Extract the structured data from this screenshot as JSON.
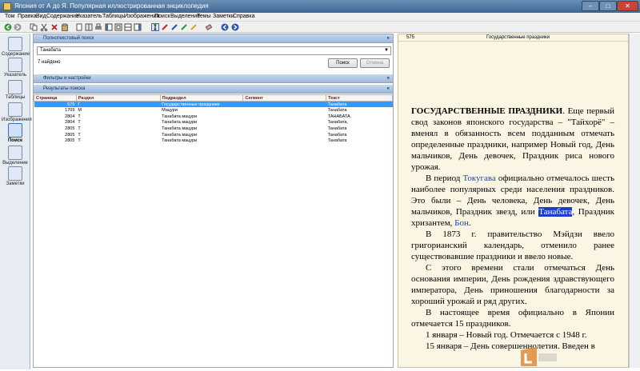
{
  "window": {
    "title": "Япония от А до Я. Популярная иллюстрированная энциклопедия"
  },
  "menu": [
    "Том",
    "Правка",
    "Вид",
    "Содержание",
    "Указатель",
    "Таблицы",
    "Изображения",
    "Поиск",
    "Выделение",
    "Темы",
    "Заметки",
    "Справка"
  ],
  "sidebar": {
    "items": [
      {
        "label": "Содержание"
      },
      {
        "label": "Указатель"
      },
      {
        "label": "Таблицы"
      },
      {
        "label": "Изображения"
      },
      {
        "label": "Поиск"
      },
      {
        "label": "Выделение"
      },
      {
        "label": "Заметки"
      }
    ]
  },
  "search": {
    "section_title": "Полнотекстовый поиск",
    "query": "Танабата",
    "found": "7 найдено",
    "search_button": "Поиск",
    "cancel_button": "Отмена",
    "filters_title": "Фильтры и настройки",
    "results_title": "Результаты поиска"
  },
  "results": {
    "columns": [
      "Страница",
      "Раздел",
      "Подраздел",
      "Сегмент",
      "Текст"
    ],
    "rows": [
      [
        "575",
        "Г",
        "Государственные праздники",
        "",
        "Танабата"
      ],
      [
        "1709",
        "М",
        "Мацури",
        "",
        "Танабата"
      ],
      [
        "2804",
        "Т",
        "Танабата мацури",
        "",
        "ТАНАБАТА"
      ],
      [
        "2804",
        "Т",
        "Танабата мацури",
        "",
        "Танабата,"
      ],
      [
        "2805",
        "Т",
        "Танабата мацури",
        "",
        "Танабата"
      ],
      [
        "2805",
        "Т",
        "Танабата мацури",
        "",
        "Танабата"
      ],
      [
        "2805",
        "Т",
        "Танабата мацури",
        "",
        "Танабата"
      ]
    ]
  },
  "page": {
    "number": "575",
    "title": "Государственные праздники"
  },
  "article": {
    "heading": "ГОСУДАРСТВЕННЫЕ ПРАЗДНИКИ",
    "p1": ". Еще первый свод законов японского государства – \"Тайхорё\" – вменял в обязанность всем подданным отмечать определенные праздники, например Новый год, День мальчиков, День девочек, Праздник риса нового урожая.",
    "p2a": "В период ",
    "p2_link1": "Токугава",
    "p2b": " официально отмечалось шесть наиболее популярных среди населения праздников. Это были – День человека, День девочек, День мальчиков, Праздник звезд, или ",
    "p2_hl": "Танабата",
    "p2c": ", Праздник хризантем, ",
    "p2_link2": "Бон",
    "p2d": ".",
    "p3": "В 1873 г. правительство Мэйдзи ввело григорианский календарь, отменило ранее существовавшие праздники и ввело новые.",
    "p4": "С этого времени стали отмечаться День основания империи, День рождения здравствующего императора, День приношения благодарности за хороший урожай и ряд других.",
    "p5": "В настоящее время официально в Японии отмечается 15 праздников.",
    "p6": "1 января – Новый год. Отмечается с 1948 г.",
    "p7": "15 января – День совершеннолетия. Введен в"
  },
  "colors": {
    "selection": "#3399ff",
    "highlight": "#1e3ccc",
    "link": "#1a3fbf",
    "paper": "#fbf6e3"
  }
}
